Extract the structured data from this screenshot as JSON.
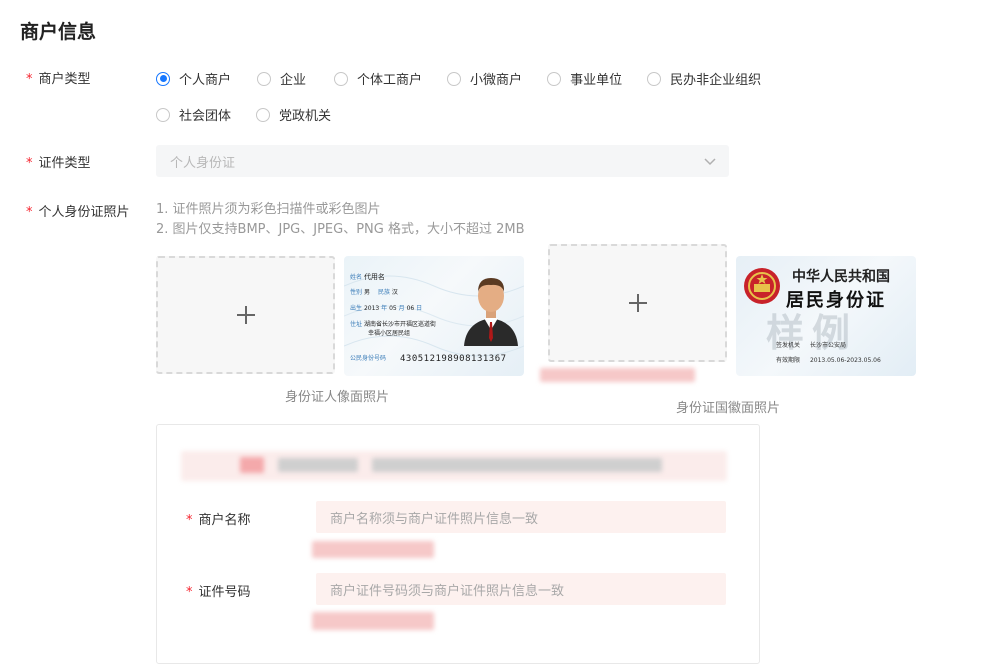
{
  "page": {
    "title": "商户信息"
  },
  "merchant_type": {
    "label": "商户类型",
    "options": [
      "个人商户",
      "企业",
      "个体工商户",
      "小微商户",
      "事业单位",
      "民办非企业组织",
      "社会团体",
      "党政机关"
    ],
    "selected": "个人商户"
  },
  "cert_type": {
    "label": "证件类型",
    "value": "个人身份证",
    "icon": "chevron-down-icon"
  },
  "id_photo": {
    "label": "个人身份证照片",
    "hints": [
      "1. 证件照片须为彩色扫描件或彩色图片",
      "2. 图片仅支持BMP、JPG、JPEG、PNG 格式，大小不超过 2MB"
    ],
    "front": {
      "caption": "身份证人像面照片",
      "sample": {
        "name_key": "姓名",
        "name": "代用名",
        "gender_key": "性别",
        "gender": "男",
        "ethnic_key": "民族",
        "ethnic": "汉",
        "birth_key": "出生",
        "birth_year": "2013",
        "year_unit": "年",
        "birth_month": "05",
        "month_unit": "月",
        "birth_day": "06",
        "day_unit": "日",
        "address_key": "住址",
        "address_line1": "湖南省长沙市开福区巡道街",
        "address_line2": "幸福小区居民组",
        "id_key": "公民身份号码",
        "id_number": "430512198908131367"
      }
    },
    "back": {
      "caption": "身份证国徽面照片",
      "sample": {
        "country": "中华人民共和国",
        "card_title": "居民身份证",
        "watermark": "样例",
        "authority_key": "签发机关",
        "authority": "长沙市公安局",
        "valid_key": "有效期限",
        "valid_range": "2013.05.06-2023.05.06"
      }
    }
  },
  "form": {
    "merchant_name": {
      "label": "商户名称",
      "placeholder": "商户名称须与商户证件照片信息一致"
    },
    "cert_number": {
      "label": "证件号码",
      "placeholder": "商户证件号码须与商户证件照片信息一致"
    }
  },
  "colors": {
    "primary": "#1677ff",
    "required": "#f5222d",
    "input_bg": "#fdf1ef",
    "select_bg": "#f5f6f7"
  }
}
